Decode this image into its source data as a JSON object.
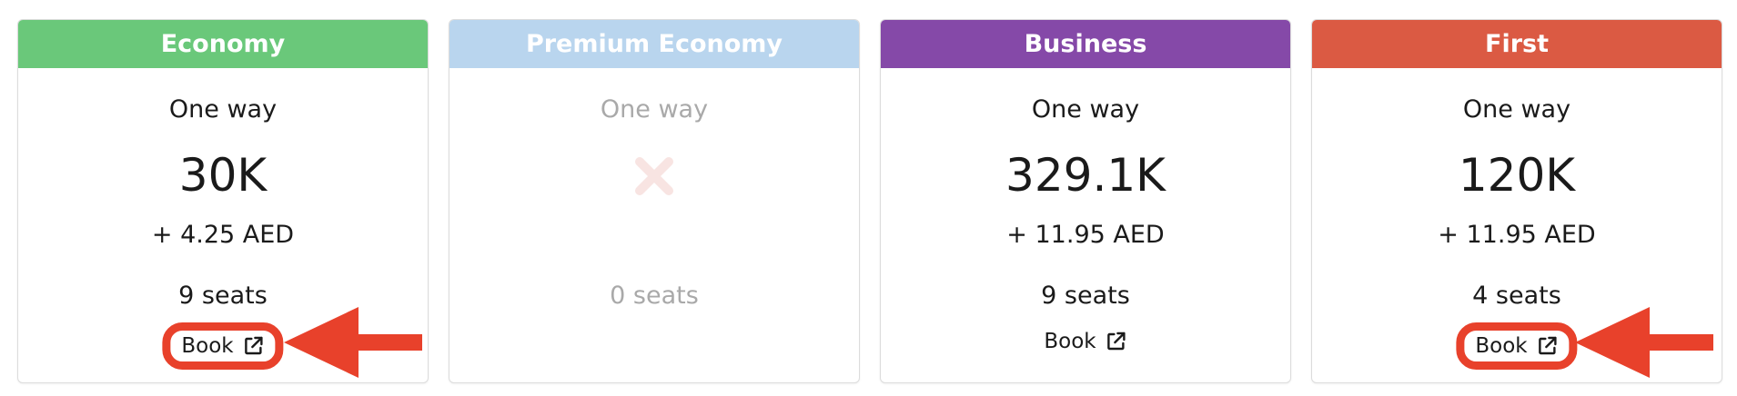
{
  "colors": {
    "economy": "#6ac87a",
    "premium_economy": "#b9d5ee",
    "business": "#8549a8",
    "first": "#db5a43",
    "annotation_red": "#e8412b"
  },
  "icons": {
    "external_link": "external-link-icon",
    "unavailable": "close-x-icon",
    "annotation_arrow": "arrow-left-icon"
  },
  "cards": [
    {
      "header": "Economy",
      "trip": "One way",
      "price": "30K",
      "tax": "+ 4.25 AED",
      "seats": "9 seats",
      "book": "Book",
      "available": true,
      "highlighted": true
    },
    {
      "header": "Premium Economy",
      "trip": "One way",
      "price": "",
      "tax": "",
      "seats": "0 seats",
      "book": "",
      "available": false,
      "highlighted": false
    },
    {
      "header": "Business",
      "trip": "One way",
      "price": "329.1K",
      "tax": "+ 11.95 AED",
      "seats": "9 seats",
      "book": "Book",
      "available": true,
      "highlighted": false
    },
    {
      "header": "First",
      "trip": "One way",
      "price": "120K",
      "tax": "+ 11.95 AED",
      "seats": "4 seats",
      "book": "Book",
      "available": true,
      "highlighted": true
    }
  ]
}
